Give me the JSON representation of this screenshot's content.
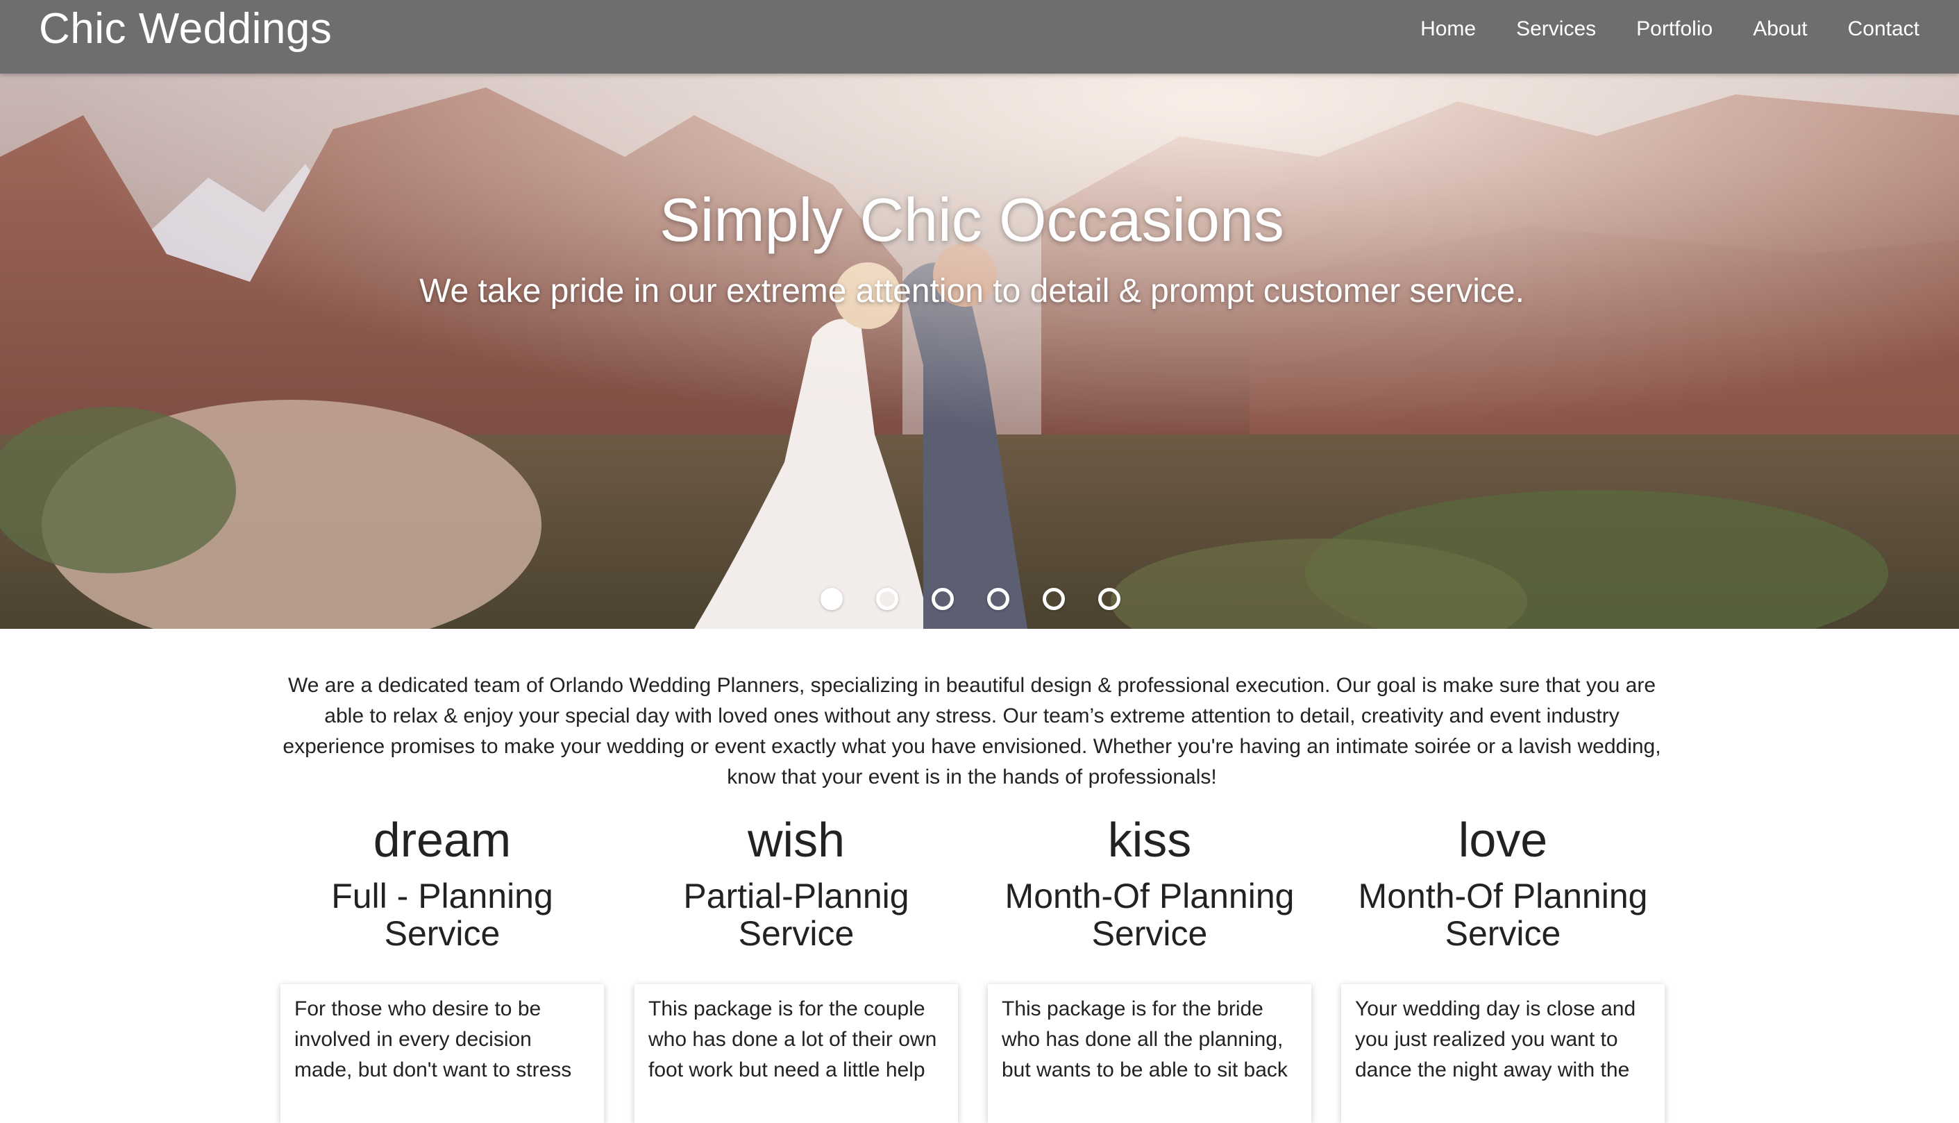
{
  "nav": {
    "brand": "Chic Weddings",
    "links": [
      "Home",
      "Services",
      "Portfolio",
      "About",
      "Contact"
    ]
  },
  "hero": {
    "title": "Simply Chic Occasions",
    "subtitle": "We take pride in our extreme attention to detail & prompt customer service.",
    "slide_count": 6,
    "active_slide": 1
  },
  "intro": {
    "text": "We are a dedicated team of Orlando Wedding Planners, specializing in beautiful design & professional execution. Our goal is make sure that you are able to relax & enjoy your special day with loved ones without any stress. Our team’s extreme attention to detail, creativity and event industry experience promises to make your wedding or event exactly what you have envisioned. Whether you're having an intimate soirée or a lavish wedding, know that your event is in the hands of professionals!"
  },
  "services": [
    {
      "word": "dream",
      "title": "Full - Planning Service",
      "description": "For those who desire to be involved in every decision made, but don't want to stress"
    },
    {
      "word": "wish",
      "title": "Partial-Plannig Service",
      "description": "This package is for the couple who has done a lot of their own foot work but need a little help"
    },
    {
      "word": "kiss",
      "title": "Month-Of Planning Service",
      "description": "This package is for the bride who has done all the planning, but wants to be able to sit back"
    },
    {
      "word": "love",
      "title": "Month-Of Planning Service",
      "description": "Your wedding day is close and you just realized you want to dance the night away with the"
    }
  ],
  "colors": {
    "navbar_bg": "#6e6e6e",
    "text": "#222222",
    "hero_tint": "#8a6a63"
  }
}
